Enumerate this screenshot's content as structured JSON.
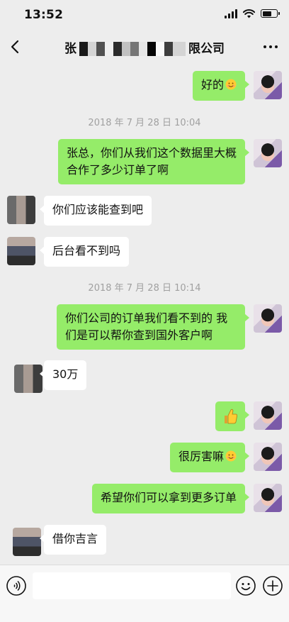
{
  "status_bar": {
    "time": "13:52"
  },
  "nav": {
    "title_prefix": "张",
    "title_suffix": "限公司"
  },
  "messages": [
    {
      "side": "self",
      "text": "好的",
      "emoji": "smile"
    },
    {
      "type": "time",
      "text": "2018 年 7 月 28 日 10:04"
    },
    {
      "side": "self",
      "text": "张总，你们从我们这个数据里大概合作了多少订单了啊"
    },
    {
      "side": "other",
      "text": "你们应该能查到吧"
    },
    {
      "side": "other",
      "text": "后台看不到吗"
    },
    {
      "type": "time",
      "text": "2018 年 7 月 28 日 10:14"
    },
    {
      "side": "self",
      "text": "你们公司的订单我们看不到的 我们是可以帮你查到国外客户啊"
    },
    {
      "side": "other",
      "text": "30万"
    },
    {
      "side": "self",
      "emoji": "thumbs-up"
    },
    {
      "side": "self",
      "text": "很厉害嘛",
      "emoji": "smile"
    },
    {
      "side": "self",
      "text": "希望你们可以拿到更多订单"
    },
    {
      "side": "other",
      "text": "借你吉言"
    }
  ],
  "colors": {
    "self_bubble": "#95ec69",
    "other_bubble": "#ffffff",
    "background": "#ededed"
  }
}
